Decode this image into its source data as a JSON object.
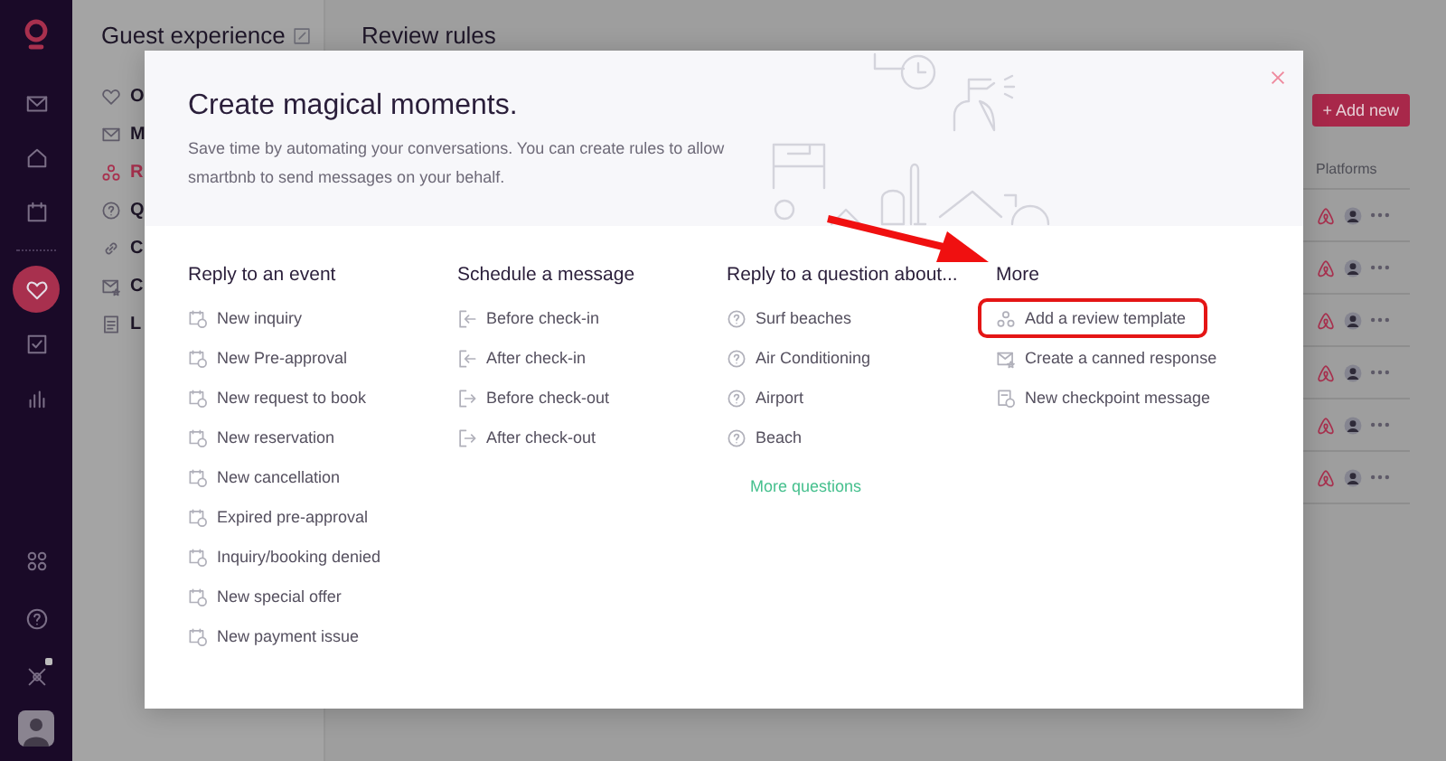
{
  "nav": {
    "items": [
      {
        "kind": "inbox",
        "selected": false
      },
      {
        "kind": "home",
        "selected": false
      },
      {
        "kind": "calendar",
        "selected": false
      },
      {
        "kind": "heart",
        "selected": true
      },
      {
        "kind": "check",
        "selected": false
      },
      {
        "kind": "chart",
        "selected": false
      }
    ],
    "bottom_items": [
      {
        "kind": "integrations"
      },
      {
        "kind": "help"
      },
      {
        "kind": "tools"
      }
    ]
  },
  "panel": {
    "title": "Guest experience",
    "items": [
      {
        "label": "O",
        "kind": "heart",
        "selected": false
      },
      {
        "label": "M",
        "kind": "mail",
        "selected": false
      },
      {
        "label": "R",
        "kind": "review",
        "selected": true
      },
      {
        "label": "Q",
        "kind": "question",
        "selected": false
      },
      {
        "label": "C",
        "kind": "link",
        "selected": false
      },
      {
        "label": "C",
        "kind": "canned",
        "selected": false
      },
      {
        "label": "L",
        "kind": "log",
        "selected": false
      }
    ]
  },
  "main": {
    "title": "Review rules",
    "add_button": "+ Add new",
    "table": {
      "columns": [
        "Platforms"
      ],
      "rows": [
        {
          "kind": "airbnb"
        },
        {
          "kind": "airbnb"
        },
        {
          "kind": "airbnb"
        },
        {
          "kind": "airbnb"
        },
        {
          "kind": "airbnb"
        },
        {
          "kind": "airbnb"
        }
      ]
    }
  },
  "modal": {
    "title": "Create magical moments.",
    "subtitle": "Save time by automating your conversations. You can create rules to allow smartbnb to send messages on your behalf.",
    "sections": [
      {
        "heading": "Reply to an event",
        "items": [
          {
            "label": "New inquiry",
            "kind": "event"
          },
          {
            "label": "New Pre-approval",
            "kind": "event"
          },
          {
            "label": "New request to book",
            "kind": "event"
          },
          {
            "label": "New reservation",
            "kind": "event"
          },
          {
            "label": "New cancellation",
            "kind": "event"
          },
          {
            "label": "Expired pre-approval",
            "kind": "event"
          },
          {
            "label": "Inquiry/booking denied",
            "kind": "event"
          },
          {
            "label": "New special offer",
            "kind": "event"
          },
          {
            "label": "New payment issue",
            "kind": "event"
          }
        ]
      },
      {
        "heading": "Schedule a message",
        "items": [
          {
            "label": "Before check-in",
            "kind": "checkin"
          },
          {
            "label": "After check-in",
            "kind": "checkin"
          },
          {
            "label": "Before check-out",
            "kind": "checkout"
          },
          {
            "label": "After check-out",
            "kind": "checkout"
          }
        ]
      },
      {
        "heading": "Reply to a question about...",
        "items": [
          {
            "label": "Surf beaches",
            "kind": "question"
          },
          {
            "label": "Air Conditioning",
            "kind": "question"
          },
          {
            "label": "Airport",
            "kind": "question"
          },
          {
            "label": "Beach",
            "kind": "question"
          }
        ],
        "link": "More questions"
      },
      {
        "heading": "More",
        "items": [
          {
            "label": "Add a review template",
            "kind": "review",
            "highlighted": true
          },
          {
            "label": "Create a canned response",
            "kind": "canned",
            "highlighted": false
          },
          {
            "label": "New checkpoint message",
            "kind": "checkpoint",
            "highlighted": false
          }
        ]
      }
    ]
  }
}
